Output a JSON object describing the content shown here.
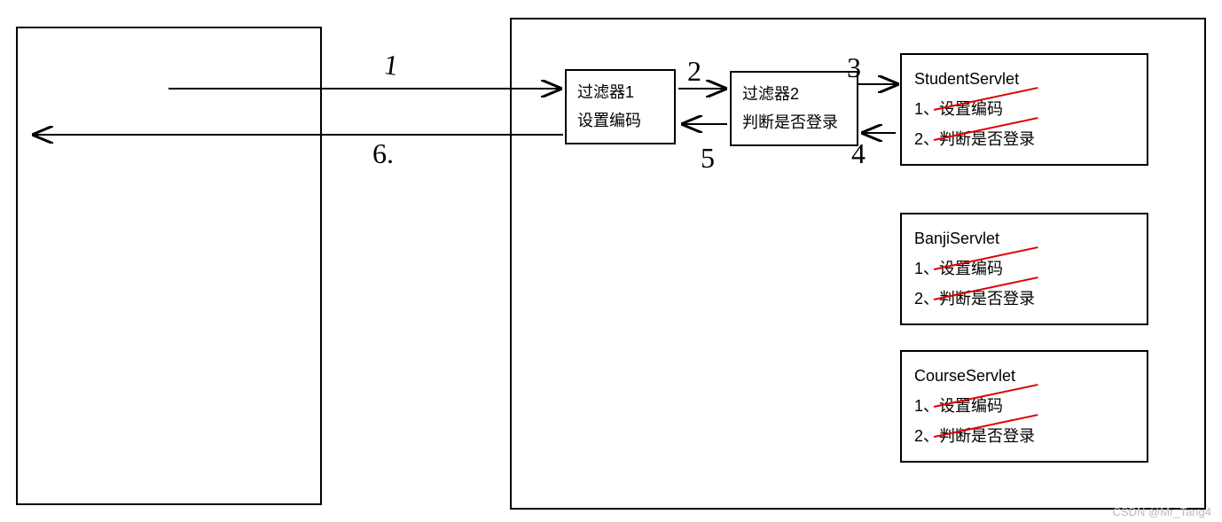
{
  "diagram": {
    "filter1": {
      "title": "过滤器1",
      "line": "设置编码"
    },
    "filter2": {
      "title": "过滤器2",
      "line": "判断是否登录"
    },
    "servlets": [
      {
        "title": "StudentServlet",
        "item1": "1、设置编码",
        "item2": "2、判断是否登录"
      },
      {
        "title": "BanjiServlet",
        "item1": "1、设置编码",
        "item2": "2、判断是否登录"
      },
      {
        "title": "CourseServlet",
        "item1": "1、设置编码",
        "item2": "2、判断是否登录"
      }
    ],
    "steps": {
      "n1": "1",
      "n2": "2",
      "n3": "3",
      "n4": "4",
      "n5": "5",
      "n6": "6."
    },
    "watermark": "CSDN @Mr_Tang4"
  }
}
